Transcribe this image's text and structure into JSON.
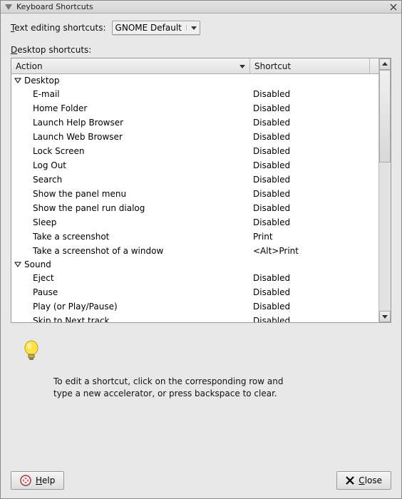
{
  "window": {
    "title": "Keyboard Shortcuts"
  },
  "scheme": {
    "label_pre": "T",
    "label_post": "ext editing shortcuts:",
    "selected": "GNOME Default"
  },
  "desktop_label_pre": "D",
  "desktop_label_post": "esktop shortcuts:",
  "columns": {
    "action": "Action",
    "shortcut": "Shortcut"
  },
  "groups": [
    {
      "name": "Desktop",
      "items": [
        {
          "action": "E-mail",
          "shortcut": "Disabled"
        },
        {
          "action": "Home Folder",
          "shortcut": "Disabled"
        },
        {
          "action": "Launch Help Browser",
          "shortcut": "Disabled"
        },
        {
          "action": "Launch Web Browser",
          "shortcut": "Disabled"
        },
        {
          "action": "Lock Screen",
          "shortcut": "Disabled"
        },
        {
          "action": "Log Out",
          "shortcut": "Disabled"
        },
        {
          "action": "Search",
          "shortcut": "Disabled"
        },
        {
          "action": "Show the panel menu",
          "shortcut": "Disabled"
        },
        {
          "action": "Show the panel run dialog",
          "shortcut": "Disabled"
        },
        {
          "action": "Sleep",
          "shortcut": "Disabled"
        },
        {
          "action": "Take a screenshot",
          "shortcut": "Print"
        },
        {
          "action": "Take a screenshot of a window",
          "shortcut": "<Alt>Print"
        }
      ]
    },
    {
      "name": "Sound",
      "items": [
        {
          "action": "Eject",
          "shortcut": "Disabled"
        },
        {
          "action": "Pause",
          "shortcut": "Disabled"
        },
        {
          "action": "Play (or Play/Pause)",
          "shortcut": "Disabled"
        },
        {
          "action": "Skip to Next track",
          "shortcut": "Disabled"
        }
      ]
    }
  ],
  "hint": {
    "line1": "To edit a shortcut, click on the corresponding row and",
    "line2": "type a new accelerator, or press backspace to clear."
  },
  "buttons": {
    "help_pre": "H",
    "help_post": "elp",
    "close_pre": "C",
    "close_post": "lose"
  }
}
